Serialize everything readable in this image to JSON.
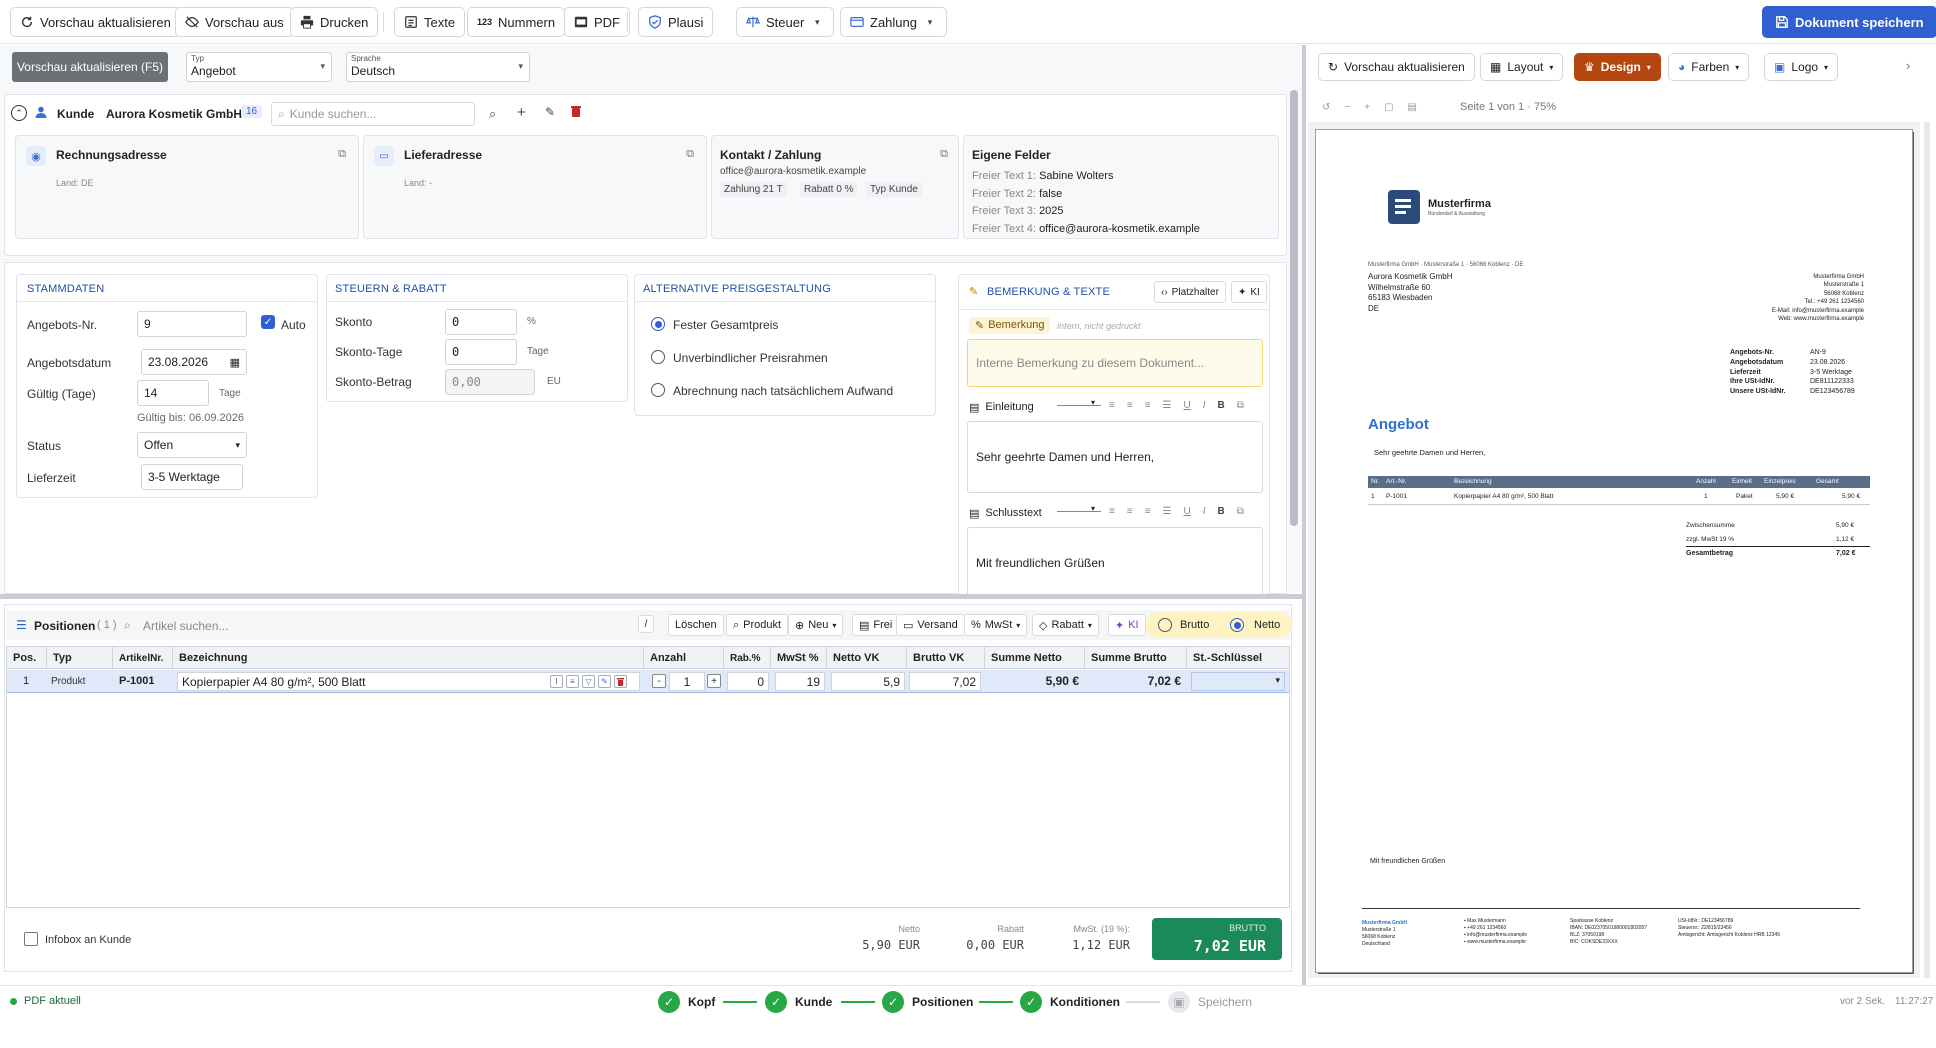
{
  "toolbar": {
    "refresh": "Vorschau aktualisieren",
    "preview_off": "Vorschau aus",
    "print": "Drucken",
    "texts": "Texte",
    "numbers": "Nummern",
    "numbers_icon_text": "123",
    "pdf": "PDF",
    "plausi": "Plausi",
    "tax": "Steuer",
    "payment": "Zahlung",
    "save": "Dokument speichern"
  },
  "subbar": {
    "refresh_f5": "Vorschau aktualisieren (F5)",
    "type_label": "Typ",
    "type_value": "Angebot",
    "lang_label": "Sprache",
    "lang_value": "Deutsch"
  },
  "customer": {
    "label": "Kunde",
    "name": "Aurora Kosmetik GmbH",
    "badge": "16",
    "search_placeholder": "Kunde suchen...",
    "billing_title": "Rechnungsadresse",
    "billing_country": "Land: DE",
    "delivery_title": "Lieferadresse",
    "delivery_country": "Land: -",
    "contact_title": "Kontakt / Zahlung",
    "contact_email": "office@aurora-kosmetik.example",
    "chip_payment": "Zahlung 21 T",
    "chip_discount": "Rabatt 0 %",
    "chip_type": "Typ Kunde",
    "custom_title": "Eigene Felder",
    "custom_fields": [
      {
        "k": "Freier Text 1:",
        "v": "Sabine Wolters"
      },
      {
        "k": "Freier Text 2:",
        "v": "false"
      },
      {
        "k": "Freier Text 3:",
        "v": "2025"
      },
      {
        "k": "Freier Text 4:",
        "v": "office@aurora-kosmetik.example"
      }
    ]
  },
  "master": {
    "title": "Stammdaten",
    "nr_label": "Angebots-Nr.",
    "nr_value": "9",
    "auto_label": "Auto",
    "date_label": "Angebotsdatum",
    "date_value": "23.08.2026",
    "valid_label": "Gültig (Tage)",
    "valid_value": "14",
    "valid_unit": "Tage",
    "valid_until": "Gültig bis: 06.09.2026",
    "status_label": "Status",
    "status_value": "Offen",
    "delivery_label": "Lieferzeit",
    "delivery_value": "3-5 Werktage"
  },
  "tax": {
    "title": "Steuern & Rabatt",
    "skonto_label": "Skonto",
    "skonto_value": "0",
    "skonto_unit": "%",
    "days_label": "Skonto-Tage",
    "days_value": "0",
    "days_unit": "Tage",
    "amount_label": "Skonto-Betrag",
    "amount_value": "0,00",
    "amount_unit": "EU"
  },
  "pricing": {
    "title": "Alternative Preisgestaltung",
    "options": [
      "Fester Gesamtpreis",
      "Unverbindlicher Preisrahmen",
      "Abrechnung nach tatsächlichem Aufwand"
    ]
  },
  "remarks": {
    "title": "Bemerkung & Texte",
    "placeholder_btn": "Platzhalter",
    "ai_btn": "KI",
    "note_label": "Bemerkung",
    "note_hint": "intern, nicht gedruckt",
    "note_placeholder": "Interne Bemerkung zu diesem Dokument...",
    "intro_label": "Einleitung",
    "intro_text": "Sehr geehrte Damen und Herren,",
    "closing_label": "Schlusstext",
    "closing_text": "Mit freundlichen Grüßen"
  },
  "positions": {
    "title": "Positionen",
    "count": "( 1 )",
    "search_placeholder": "Artikel suchen...",
    "slash": "/",
    "btn_delete": "Löschen",
    "btn_product": "Produkt",
    "btn_new": "Neu",
    "btn_free": "Frei",
    "btn_shipping": "Versand",
    "btn_vat": "MwSt",
    "btn_discount": "Rabatt",
    "btn_ai": "KI",
    "brutto": "Brutto",
    "netto": "Netto",
    "columns": [
      "Pos.",
      "Typ",
      "ArtikelNr.",
      "Bezeichnung",
      "Anzahl",
      "Rab.%",
      "MwSt %",
      "Netto VK",
      "Brutto VK",
      "Summe Netto",
      "Summe Brutto",
      "St.-Schlüssel"
    ],
    "rows": [
      {
        "pos": "1",
        "type": "Produkt",
        "nr": "P-1001",
        "desc": "Kopierpapier A4 80 g/m², 500 Blatt",
        "qty": "1",
        "disc": "0",
        "vat": "19",
        "net": "5,9",
        "gross": "7,02",
        "sum_net": "5,90 €",
        "sum_gross": "7,02 €"
      }
    ],
    "infobox": "Infobox an Kunde",
    "net_label": "Netto",
    "net_value": "5,90 EUR",
    "disc_label": "Rabatt",
    "disc_value": "0,00 EUR",
    "vat_label": "MwSt. (19 %):",
    "vat_value": "1,12 EUR",
    "total_label": "BRUTTO",
    "total_value": "7,02 EUR"
  },
  "preview": {
    "refresh": "Vorschau aktualisieren",
    "layout": "Layout",
    "design": "Design",
    "colors": "Farben",
    "logo": "Logo",
    "page_info": "Seite 1 von 1 · 75%"
  },
  "pdf": {
    "company": "Musterfirma",
    "tagline": "Bürobedarf & Ausstattung",
    "sender_line": "Musterfirma GmbH · Musterstraße 1 · 56068 Koblenz · DE",
    "recipient": [
      "Aurora Kosmetik GmbH",
      "Wilhelmstraße 60",
      "65183 Wiesbaden",
      "DE"
    ],
    "sender_block": [
      "Musterfirma GmbH",
      "Musterstraße 1",
      "56068 Koblenz",
      "Tel.: +49 261 1234560",
      "E-Mail: info@musterfirma.example",
      "Web: www.musterfirma.example"
    ],
    "meta": [
      {
        "k": "Angebots-Nr.",
        "v": "AN-9"
      },
      {
        "k": "Angebotsdatum",
        "v": "23.08.2026"
      },
      {
        "k": "Lieferzeit",
        "v": "3-5 Werktage"
      },
      {
        "k": "Ihre USt-IdNr.",
        "v": "DE811122333"
      },
      {
        "k": "Unsere USt-IdNr.",
        "v": "DE123456789"
      }
    ],
    "doc_title": "Angebot",
    "salutation": "Sehr geehrte Damen und Herren,",
    "table_head": [
      "Nr.",
      "Art.-Nr.",
      "Bezeichnung",
      "Anzahl",
      "Einheit",
      "Einzelpreis",
      "Gesamt"
    ],
    "table_row": [
      "1",
      "P-1001",
      "Kopierpapier A4 80 g/m², 500 Blatt",
      "1",
      "Paket",
      "5,90 €",
      "5,90 €"
    ],
    "subtotal_label": "Zwischensumme",
    "subtotal_value": "5,90 €",
    "vat_label": "zzgl. MwSt 19 %",
    "vat_value": "1,12 €",
    "total_label": "Gesamtbetrag",
    "total_value": "7,02 €",
    "closing": "Mit freundlichen Grüßen",
    "footer": {
      "col1": [
        "Musterfirma GmbH",
        "Musterstraße 1",
        "56068 Koblenz",
        "Deutschland"
      ],
      "col2": [
        "Max Mustermann",
        "+49 261 1234560",
        "info@musterfirma.example",
        "www.musterfirma.example"
      ],
      "col3": [
        "Sparkasse Koblenz",
        "IBAN: DE02370501980001802057",
        "BLZ: 37050198",
        "BIC: COKSDE33XXX"
      ],
      "col4": [
        "USt-IdNr.: DE123456789",
        "Steuernr.: 22/815/23456",
        "Amtsgericht: Amtsgericht Koblenz HRB 12345"
      ]
    }
  },
  "status": {
    "pdf_state": "PDF aktuell",
    "steps": [
      "Kopf",
      "Kunde",
      "Positionen",
      "Konditionen",
      "Speichern"
    ],
    "ago": "vor 2 Sek.",
    "time": "11:27:27"
  }
}
